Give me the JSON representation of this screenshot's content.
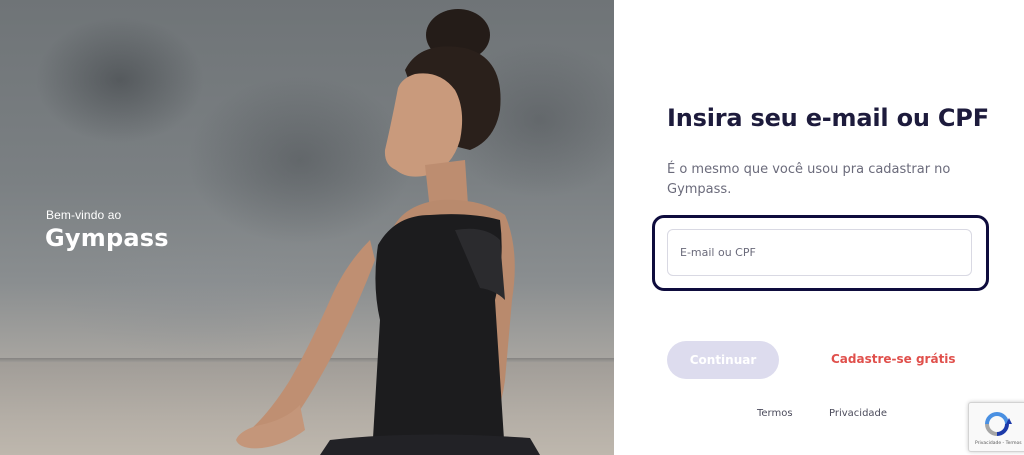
{
  "hero": {
    "welcome_text": "Bem-vindo ao",
    "brand_name": "Gympass"
  },
  "form": {
    "title": "Insira seu e-mail ou CPF",
    "subtitle": "É o mesmo que você usou pra cadastrar no Gympass.",
    "input": {
      "placeholder": "E-mail ou CPF",
      "value": ""
    },
    "continue_label": "Continuar",
    "signup_label": "Cadastre-se grátis"
  },
  "footer": {
    "terms_label": "Termos",
    "privacy_label": "Privacidade"
  },
  "recaptcha": {
    "legal_text": "Privacidade - Termos"
  },
  "colors": {
    "title": "#1d1b3c",
    "focus_ring": "#0e0c3d",
    "button_disabled": "#dddcee",
    "signup_link": "#e0504c"
  }
}
